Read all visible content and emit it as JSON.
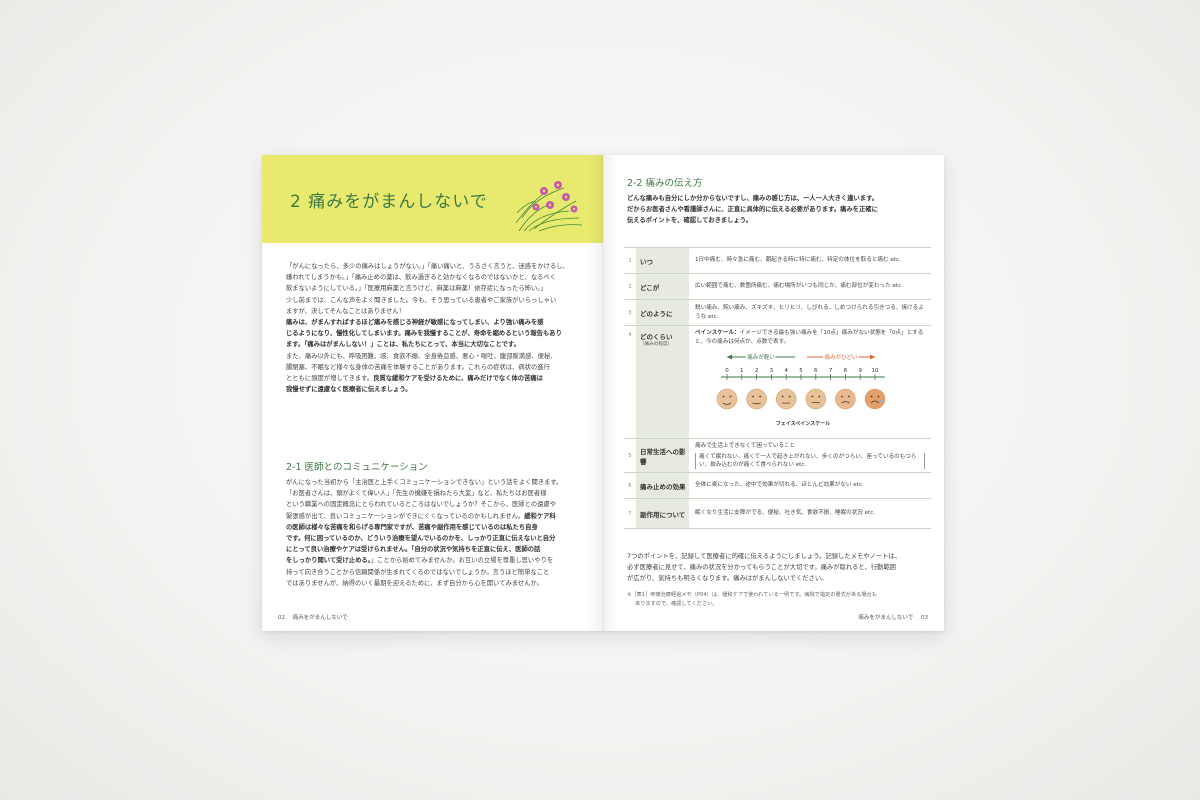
{
  "left": {
    "chapter_title": "2 痛みをがまんしないで",
    "intro": [
      "「がんになったら、多少の痛みはしょうがない。」「痛い痛いと、うるさく言うと、迷惑をかけるし、",
      "嫌われてしまうかも。」「痛み止めの薬は、飲み過ぎると効かなくなるのではないかと、なるべく",
      "飲まないようにしている。」「医療用麻薬と言うけど、麻薬は麻薬！依存症になったら怖い。」",
      "少し前までは、こんな声をよく聞きました。今も、そう思っている患者やご家族がいらっしゃい",
      "ますが、決してそんなことはありません！"
    ],
    "intro_bold": [
      "痛みは、がまんすればするほど痛みを感じる神経が敏感になってしまい、より強い痛みを感",
      "じるようになり、慢性化してしまいます。痛みを我慢することが、寿命を縮めるという報告もあり",
      "ます。「痛みはがまんしない！」ことは、私たちにとって、本当に大切なことです。"
    ],
    "intro_tail": [
      "また、痛み以外にも、呼吸困難、咳、食欲不振、全身倦怠感、悪心・嘔吐、腹部膨満感、便秘、",
      "腸閉塞、不眠など様々な身体の苦痛を体験することがあります。これらの症状は、病状の進行",
      "とともに頻度が増してきます。"
    ],
    "intro_tail_bold": "良質な緩和ケアを受けるために、痛みだけでなく体の苦痛は",
    "intro_last_bold": "我慢せずに遠慮なく医療者に伝えましょう。",
    "section_title": "2-1  医師とのコミュニケーション",
    "section_body": [
      "がんになった当初から「主治医と上手くコミュニケーションできない」という話をよく聞きます。",
      "「お医者さんは、頭がよくて偉い人」「先生の機嫌を損ねたら大変」など、私たちはお医者様",
      "という職業への固定概念にとらわれているところはないでしょうか？そこから、医師との遠慮や",
      "緊張感が出て、良いコミュニケーションができにくくなっているのかもしれません。"
    ],
    "section_body_bold": [
      "緩和ケア科",
      "の医師は様々な苦痛を和らげる専門家ですが、苦痛や副作用を感じているのは私たち自身",
      "です。何に困っているのか、どういう治療を望んでいるのかを、しっかり正直に伝えないと自分",
      "にとって良い治療やケアは受けられません。「自分の状況や気持ちを正直に伝え、医師の話",
      "をしっかり聞いて受け止める。"
    ],
    "section_body_tail": [
      "」ことから始めてみませんか。お互いの立場を尊重し思いやりを",
      "持って向き合うことから信頼関係が生まれてくるのではないでしょうか。言うほど簡単なこと",
      "ではありませんが、納得のいく最期を迎えるために、まず自分から心を開いてみませんか。"
    ],
    "folio_num": "02",
    "folio_text": "痛みをがまんしないで"
  },
  "right": {
    "section_title": "2-2  痛みの伝え方",
    "intro": [
      "どんな痛みも自分にしか分からないですし、痛みの感じ方は、一人一人大きく違います。",
      "だからお医者さんや看護師さんに、正直に具体的に伝える必要があります。痛みを正確に",
      "伝えるポイントを、確認しておきましょう。"
    ],
    "rows": [
      {
        "num": "1",
        "label": "いつ",
        "desc": "1日中痛む、時々急に痛む、朝起きる時に特に痛む、特定の体位を取ると痛む etc."
      },
      {
        "num": "2",
        "label": "どこが",
        "desc": "広い範囲で痛む、数箇所痛む、痛む場所がいつも同じか、痛む部位が変わった etc."
      },
      {
        "num": "3",
        "label": "どのように",
        "desc": "鋭い痛み、鈍い痛み、ズキズキ、ヒリヒリ、しびれる、しめつけられる引きつる、焼けるような etc."
      },
      {
        "num": "4",
        "label": "どのくらい",
        "sub": "（痛みの程度）",
        "desc_bold": "ペインスケール：",
        "desc": "イメージできる最も強い痛みを「10点」痛みがない状態を「0点」とすると、今の痛みは何点か、点数で表す。"
      },
      {
        "num": "5",
        "label": "日常生活への影響",
        "desc": "痛みで生活上できなくて困っていること",
        "paren": "痛くて眠れない、痛くて一人で起き上がれない、歩くのがつらい、座っているのもつらい、飲み込むのが痛くて食べられない etc."
      },
      {
        "num": "6",
        "label": "痛み止めの効果",
        "desc": "全体に楽になった、途中で効果が切れる、ほとんど効果がない etc."
      },
      {
        "num": "7",
        "label": "副作用について",
        "desc": "眠くなり生活に支障がでる、便秘、吐き気、食欲不振、睡眠の状況 etc."
      }
    ],
    "scale": {
      "light": "痛みが軽い",
      "severe": "痛みがひどい",
      "ticks": [
        "0",
        "1",
        "2",
        "3",
        "4",
        "5",
        "6",
        "7",
        "8",
        "9",
        "10"
      ],
      "caption": "フェイスペインスケール"
    },
    "outro": [
      "7つのポイントを、記録して医療者に的確に伝えるようにしましょう。記録したメモやノートは、",
      "必ず医療者に見せて、痛みの状況を分かってもらうことが大切です。痛みが取れると、行動範囲",
      "が広がり、気持ちも明るくなります。痛みはがまんしないでください。"
    ],
    "note": [
      "※［表1］疼痛治療経過メモ（P04）は、緩和ケアで使われている一例です。病院で指定の書式がある場合も",
      "ありますので、確認してください。"
    ],
    "folio_num": "03",
    "folio_text": "痛みをがまんしないで"
  },
  "colors": {
    "banner": "#e8ea6f",
    "accent": "#3e7a45",
    "table_label": "#e7ebdf",
    "severe": "#d96a3a"
  }
}
